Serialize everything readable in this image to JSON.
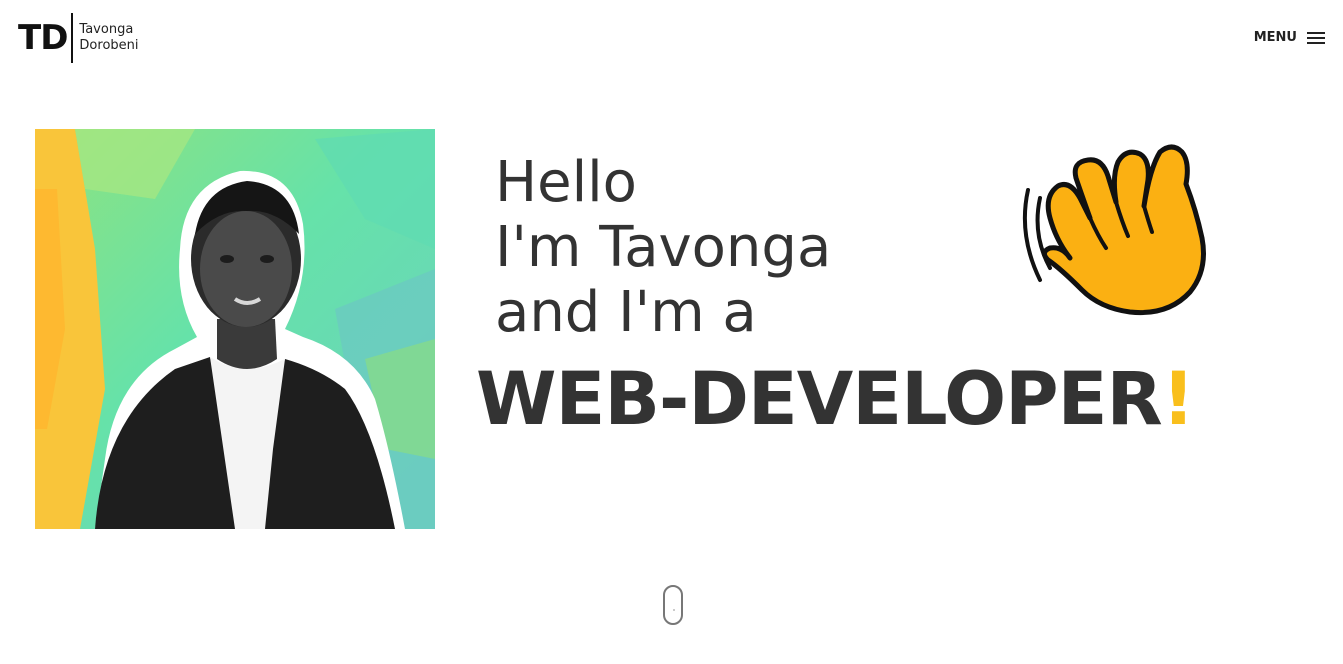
{
  "header": {
    "logo": {
      "mark": "TD",
      "first_name": "Tavonga",
      "last_name": "Dorobeni"
    },
    "menu_label": "MENU",
    "menu_icon": "hamburger-icon"
  },
  "hero": {
    "line1": "Hello",
    "line2": "I'm Tavonga",
    "line3": "and I'm a",
    "role": "WEB-DEVELOPER",
    "role_punctuation": "!",
    "wave_icon": "waving-hand-icon",
    "photo_icon": "profile-photo"
  },
  "scroll_icon": "mouse-scroll-icon",
  "colors": {
    "accent": "#f9bf1c",
    "text": "#333333",
    "photo_bg": "#6ee3a8"
  }
}
